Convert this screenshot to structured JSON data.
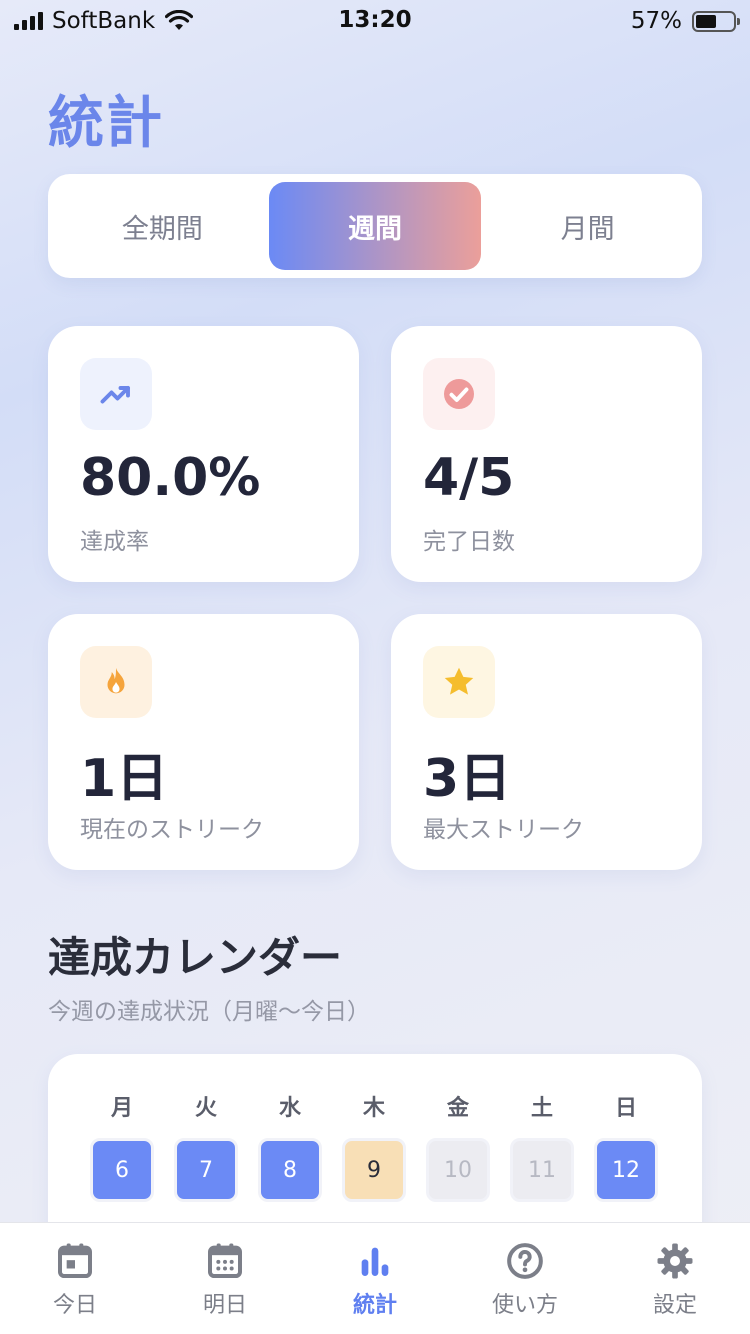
{
  "status_bar": {
    "carrier": "SoftBank",
    "time": "13:20",
    "battery": "57%"
  },
  "page_title": "統計",
  "segments": [
    {
      "label": "全期間",
      "active": false
    },
    {
      "label": "週間",
      "active": true
    },
    {
      "label": "月間",
      "active": false
    }
  ],
  "stats": {
    "rate": {
      "value": "80.0%",
      "label": "達成率",
      "icon": "trending-up-icon"
    },
    "days": {
      "value": "4/5",
      "label": "完了日数",
      "icon": "check-circle-icon"
    },
    "streak": {
      "value": "1日",
      "label": "現在のストリーク",
      "icon": "flame-icon"
    },
    "max_streak": {
      "value": "3日",
      "label": "最大ストリーク",
      "icon": "star-icon"
    }
  },
  "calendar": {
    "title": "達成カレンダー",
    "subtitle": "今週の達成状況（月曜〜今日）",
    "weekdays": [
      "月",
      "火",
      "水",
      "木",
      "金",
      "土",
      "日"
    ],
    "days": [
      {
        "num": "6",
        "state": "done"
      },
      {
        "num": "7",
        "state": "done"
      },
      {
        "num": "8",
        "state": "done"
      },
      {
        "num": "9",
        "state": "today"
      },
      {
        "num": "10",
        "state": "future"
      },
      {
        "num": "11",
        "state": "future"
      },
      {
        "num": "12",
        "state": "done"
      }
    ]
  },
  "tabs": [
    {
      "label": "今日",
      "icon": "calendar-today-icon"
    },
    {
      "label": "明日",
      "icon": "calendar-grid-icon"
    },
    {
      "label": "統計",
      "icon": "bar-chart-icon"
    },
    {
      "label": "使い方",
      "icon": "help-circle-icon"
    },
    {
      "label": "設定",
      "icon": "gear-icon"
    }
  ],
  "colors": {
    "accent": "#6b86ea",
    "done_day": "#6b8af5",
    "today_day": "#f8dfb6",
    "future_day": "#ececf1",
    "segment_gradient_start": "#6b8af5",
    "segment_gradient_end": "#eb9f9a"
  }
}
